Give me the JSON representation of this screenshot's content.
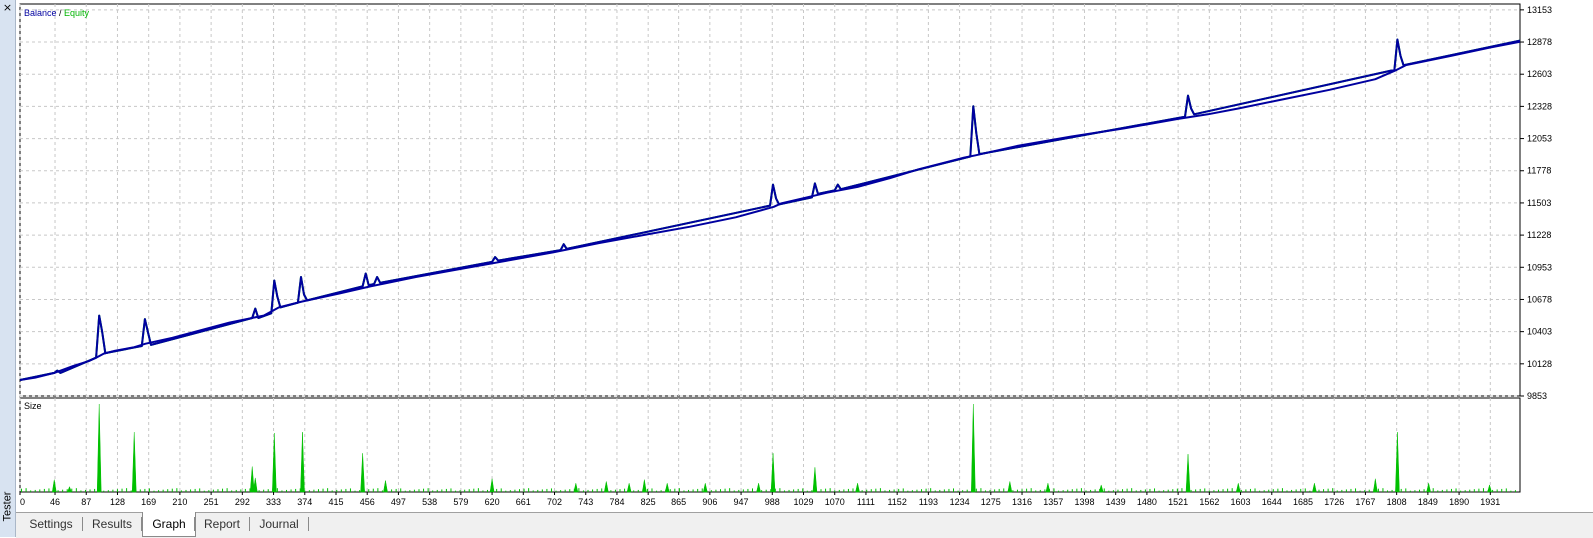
{
  "window": {
    "close_glyph": "×",
    "panel_label": "Tester"
  },
  "tabs": [
    {
      "label": "Settings",
      "active": false
    },
    {
      "label": "Results",
      "active": false
    },
    {
      "label": "Graph",
      "active": true
    },
    {
      "label": "Report",
      "active": false
    },
    {
      "label": "Journal",
      "active": false
    }
  ],
  "colors": {
    "balance": "#0000a0",
    "equity": "#00b400",
    "size_bars": "#00c000",
    "grid": "#c8c8c8"
  },
  "chart_data": [
    {
      "type": "line",
      "legend": [
        {
          "label": "Balance",
          "color": "#0000a0"
        },
        {
          "label": "Equity",
          "color": "#00b400"
        }
      ],
      "legend_separator": " / ",
      "y_ticks": [
        13153,
        12878,
        12603,
        12328,
        12053,
        11778,
        11503,
        11228,
        10953,
        10678,
        10403,
        10128,
        9853
      ],
      "ylim": [
        9853,
        13203
      ],
      "x_ticks": [
        0,
        46,
        87,
        128,
        169,
        210,
        251,
        292,
        333,
        374,
        415,
        456,
        497,
        538,
        579,
        620,
        661,
        702,
        743,
        784,
        825,
        865,
        906,
        947,
        988,
        1029,
        1070,
        1111,
        1152,
        1193,
        1234,
        1275,
        1316,
        1357,
        1398,
        1439,
        1480,
        1521,
        1562,
        1603,
        1644,
        1685,
        1726,
        1767,
        1808,
        1849,
        1890,
        1931
      ],
      "xlim": [
        0,
        1970
      ],
      "grid": true,
      "series": [
        {
          "name": "Balance",
          "points": [
            [
              0,
              9990
            ],
            [
              20,
              10010
            ],
            [
              45,
              10050
            ],
            [
              70,
              10110
            ],
            [
              90,
              10150
            ],
            [
              100,
              10180
            ],
            [
              110,
              10215
            ],
            [
              125,
              10240
            ],
            [
              150,
              10270
            ],
            [
              165,
              10300
            ],
            [
              200,
              10350
            ],
            [
              240,
              10420
            ],
            [
              275,
              10480
            ],
            [
              320,
              10540
            ],
            [
              340,
              10610
            ],
            [
              370,
              10660
            ],
            [
              420,
              10730
            ],
            [
              460,
              10790
            ],
            [
              520,
              10870
            ],
            [
              580,
              10940
            ],
            [
              640,
              11010
            ],
            [
              700,
              11080
            ],
            [
              760,
              11160
            ],
            [
              820,
              11230
            ],
            [
              880,
              11300
            ],
            [
              940,
              11380
            ],
            [
              990,
              11470
            ],
            [
              1000,
              11500
            ],
            [
              1060,
              11590
            ],
            [
              1100,
              11640
            ],
            [
              1140,
              11710
            ],
            [
              1180,
              11790
            ],
            [
              1240,
              11890
            ],
            [
              1255,
              11910
            ],
            [
              1310,
              11990
            ],
            [
              1380,
              12070
            ],
            [
              1450,
              12140
            ],
            [
              1520,
              12220
            ],
            [
              1560,
              12260
            ],
            [
              1600,
              12310
            ],
            [
              1660,
              12390
            ],
            [
              1720,
              12470
            ],
            [
              1780,
              12560
            ],
            [
              1808,
              12640
            ],
            [
              1820,
              12680
            ],
            [
              1880,
              12760
            ],
            [
              1930,
              12830
            ],
            [
              1970,
              12880
            ]
          ]
        },
        {
          "name": "Equity",
          "points": [
            [
              0,
              9990
            ],
            [
              45,
              10050
            ],
            [
              49,
              10070
            ],
            [
              53,
              10050
            ],
            [
              100,
              10180
            ],
            [
              104,
              10540
            ],
            [
              108,
              10400
            ],
            [
              112,
              10220
            ],
            [
              160,
              10280
            ],
            [
              164,
              10510
            ],
            [
              168,
              10400
            ],
            [
              172,
              10290
            ],
            [
              305,
              10520
            ],
            [
              309,
              10600
            ],
            [
              313,
              10520
            ],
            [
              330,
              10560
            ],
            [
              334,
              10840
            ],
            [
              338,
              10700
            ],
            [
              342,
              10610
            ],
            [
              365,
              10650
            ],
            [
              369,
              10870
            ],
            [
              373,
              10720
            ],
            [
              377,
              10670
            ],
            [
              450,
              10790
            ],
            [
              454,
              10900
            ],
            [
              458,
              10800
            ],
            [
              465,
              10810
            ],
            [
              469,
              10870
            ],
            [
              473,
              10820
            ],
            [
              620,
              11000
            ],
            [
              624,
              11040
            ],
            [
              628,
              11010
            ],
            [
              710,
              11100
            ],
            [
              714,
              11150
            ],
            [
              718,
              11110
            ],
            [
              985,
              11480
            ],
            [
              989,
              11660
            ],
            [
              993,
              11540
            ],
            [
              997,
              11490
            ],
            [
              1040,
              11550
            ],
            [
              1044,
              11670
            ],
            [
              1048,
              11580
            ],
            [
              1070,
              11610
            ],
            [
              1074,
              11660
            ],
            [
              1078,
              11620
            ],
            [
              1248,
              11900
            ],
            [
              1252,
              12330
            ],
            [
              1256,
              12100
            ],
            [
              1260,
              11920
            ],
            [
              1530,
              12240
            ],
            [
              1534,
              12420
            ],
            [
              1538,
              12310
            ],
            [
              1542,
              12260
            ],
            [
              1805,
              12640
            ],
            [
              1809,
              12900
            ],
            [
              1813,
              12760
            ],
            [
              1817,
              12680
            ],
            [
              1970,
              12890
            ]
          ]
        }
      ]
    },
    {
      "type": "bar",
      "title": "Size",
      "ylim": [
        0,
        1.0
      ],
      "series": [
        {
          "spikes": [
            [
              45,
              0.14
            ],
            [
              65,
              0.06
            ],
            [
              104,
              1.0
            ],
            [
              150,
              0.68
            ],
            [
              305,
              0.29
            ],
            [
              309,
              0.16
            ],
            [
              334,
              0.67
            ],
            [
              371,
              0.68
            ],
            [
              450,
              0.44
            ],
            [
              480,
              0.13
            ],
            [
              620,
              0.15
            ],
            [
              730,
              0.1
            ],
            [
              770,
              0.12
            ],
            [
              800,
              0.1
            ],
            [
              820,
              0.14
            ],
            [
              850,
              0.1
            ],
            [
              900,
              0.1
            ],
            [
              970,
              0.1
            ],
            [
              989,
              0.44
            ],
            [
              1044,
              0.28
            ],
            [
              1100,
              0.1
            ],
            [
              1252,
              1.0
            ],
            [
              1300,
              0.12
            ],
            [
              1350,
              0.1
            ],
            [
              1420,
              0.08
            ],
            [
              1534,
              0.43
            ],
            [
              1600,
              0.1
            ],
            [
              1700,
              0.1
            ],
            [
              1780,
              0.15
            ],
            [
              1809,
              0.68
            ],
            [
              1850,
              0.1
            ],
            [
              1930,
              0.08
            ]
          ]
        }
      ]
    }
  ]
}
